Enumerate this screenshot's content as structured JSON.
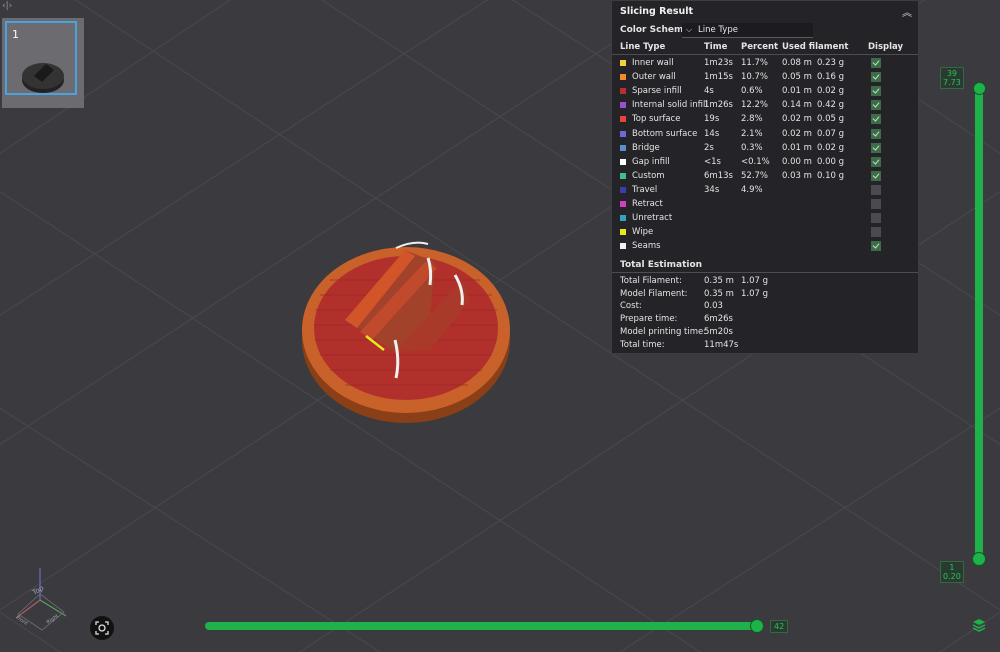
{
  "plate": {
    "number": "1"
  },
  "panel": {
    "title": "Slicing Result",
    "color_scheme_label": "Color Scheme",
    "color_scheme_value": "Line Type",
    "headers": {
      "line_type": "Line Type",
      "time": "Time",
      "percent": "Percent",
      "used_filament": "Used filament",
      "display": "Display"
    },
    "rows": [
      {
        "name": "Inner wall",
        "color": "#f4d03f",
        "time": "1m23s",
        "percent": "11.7%",
        "len": "0.08 m",
        "weight": "0.23 g",
        "display": true
      },
      {
        "name": "Outer wall",
        "color": "#f28c28",
        "time": "1m15s",
        "percent": "10.7%",
        "len": "0.05 m",
        "weight": "0.16 g",
        "display": true
      },
      {
        "name": "Sparse infill",
        "color": "#b5302f",
        "time": "4s",
        "percent": "0.6%",
        "len": "0.01 m",
        "weight": "0.02 g",
        "display": true
      },
      {
        "name": "Internal solid infill",
        "color": "#9b4fd1",
        "time": "1m26s",
        "percent": "12.2%",
        "len": "0.14 m",
        "weight": "0.42 g",
        "display": true
      },
      {
        "name": "Top surface",
        "color": "#e8433c",
        "time": "19s",
        "percent": "2.8%",
        "len": "0.02 m",
        "weight": "0.05 g",
        "display": true
      },
      {
        "name": "Bottom surface",
        "color": "#6b6bdc",
        "time": "14s",
        "percent": "2.1%",
        "len": "0.02 m",
        "weight": "0.07 g",
        "display": true
      },
      {
        "name": "Bridge",
        "color": "#5b8fc9",
        "time": "2s",
        "percent": "0.3%",
        "len": "0.01 m",
        "weight": "0.02 g",
        "display": true
      },
      {
        "name": "Gap infill",
        "color": "#ffffff",
        "time": "<1s",
        "percent": "<0.1%",
        "len": "0.00 m",
        "weight": "0.00 g",
        "display": true
      },
      {
        "name": "Custom",
        "color": "#3fbf8f",
        "time": "6m13s",
        "percent": "52.7%",
        "len": "0.03 m",
        "weight": "0.10 g",
        "display": true
      },
      {
        "name": "Travel",
        "color": "#3a3ea8",
        "time": "34s",
        "percent": "4.9%",
        "len": "",
        "weight": "",
        "display": false
      },
      {
        "name": "Retract",
        "color": "#d23fc2",
        "time": "",
        "percent": "",
        "len": "",
        "weight": "",
        "display": false
      },
      {
        "name": "Unretract",
        "color": "#2fa3c0",
        "time": "",
        "percent": "",
        "len": "",
        "weight": "",
        "display": false
      },
      {
        "name": "Wipe",
        "color": "#e8e81f",
        "time": "",
        "percent": "",
        "len": "",
        "weight": "",
        "display": false
      },
      {
        "name": "Seams",
        "color": "#f0f0f0",
        "time": "",
        "percent": "",
        "len": "",
        "weight": "",
        "display": true
      }
    ],
    "total_estimation": {
      "title": "Total Estimation",
      "rows": [
        {
          "label": "Total Filament:",
          "v1": "0.35 m",
          "v2": "1.07 g"
        },
        {
          "label": "Model Filament:",
          "v1": "0.35 m",
          "v2": "1.07 g"
        },
        {
          "label": "Cost:",
          "v1": "0.03",
          "v2": ""
        },
        {
          "label": "Prepare time:",
          "v1": "6m26s",
          "v2": ""
        },
        {
          "label": "Model printing time:",
          "v1": "5m20s",
          "v2": ""
        },
        {
          "label": "Total time:",
          "v1": "11m47s",
          "v2": ""
        }
      ]
    }
  },
  "vslider": {
    "top_layer": "39",
    "top_height": "7.73",
    "bottom_layer": "1",
    "bottom_height": "0.20"
  },
  "hslider": {
    "value": "42"
  },
  "gizmo": {
    "top_label": "Top",
    "front_label": "Front",
    "right_label": "Right"
  },
  "colors": {
    "accent": "#1fb24a",
    "background": "#3a3a3f",
    "panel": "#242428",
    "plate_orange": "#c8612a",
    "plate_red": "#b2302c"
  }
}
